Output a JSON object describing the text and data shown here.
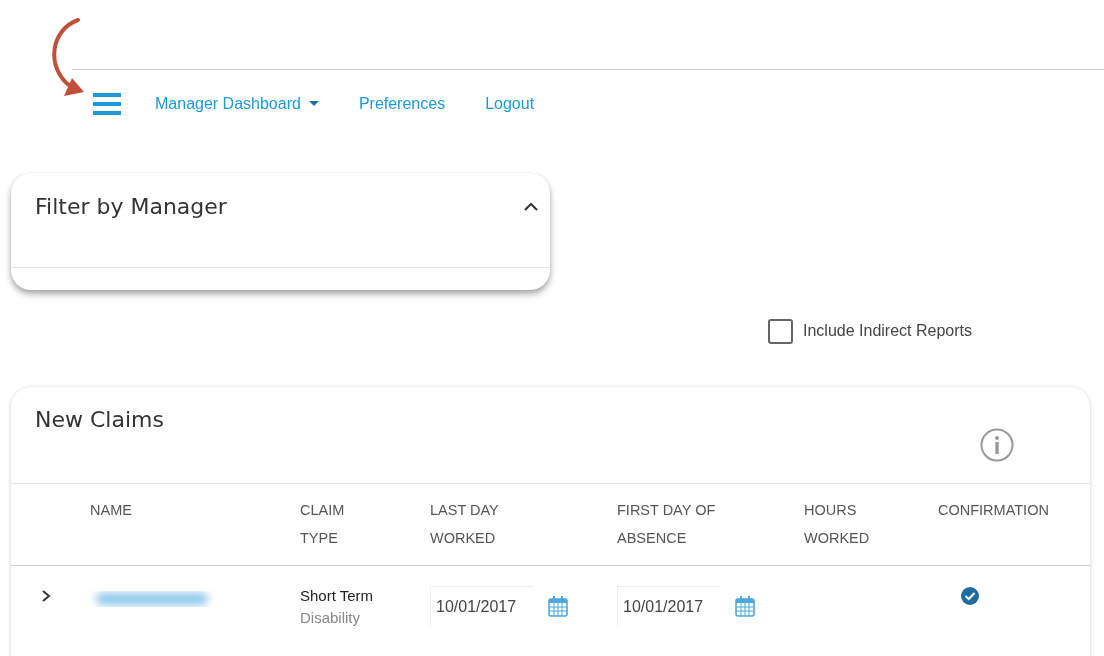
{
  "nav": {
    "links": [
      {
        "label": "Manager Dashboard",
        "dropdown": true
      },
      {
        "label": "Preferences",
        "dropdown": false
      },
      {
        "label": "Logout",
        "dropdown": false
      }
    ]
  },
  "filter_panel": {
    "title": "Filter by Manager",
    "expanded": true
  },
  "include_indirect": {
    "label": "Include Indirect Reports",
    "checked": false
  },
  "claims": {
    "title": "New Claims",
    "columns": [
      "NAME",
      "CLAIM TYPE",
      "LAST DAY WORKED",
      "FIRST DAY OF ABSENCE",
      "HOURS WORKED",
      "CONFIRMATION"
    ],
    "rows": [
      {
        "expanded": false,
        "claim_type": "Short Term",
        "claim_subtype": "Disability",
        "last_day_worked": "10/01/2017",
        "first_day_of_absence": "10/01/2017",
        "confirmed": true
      }
    ]
  }
}
